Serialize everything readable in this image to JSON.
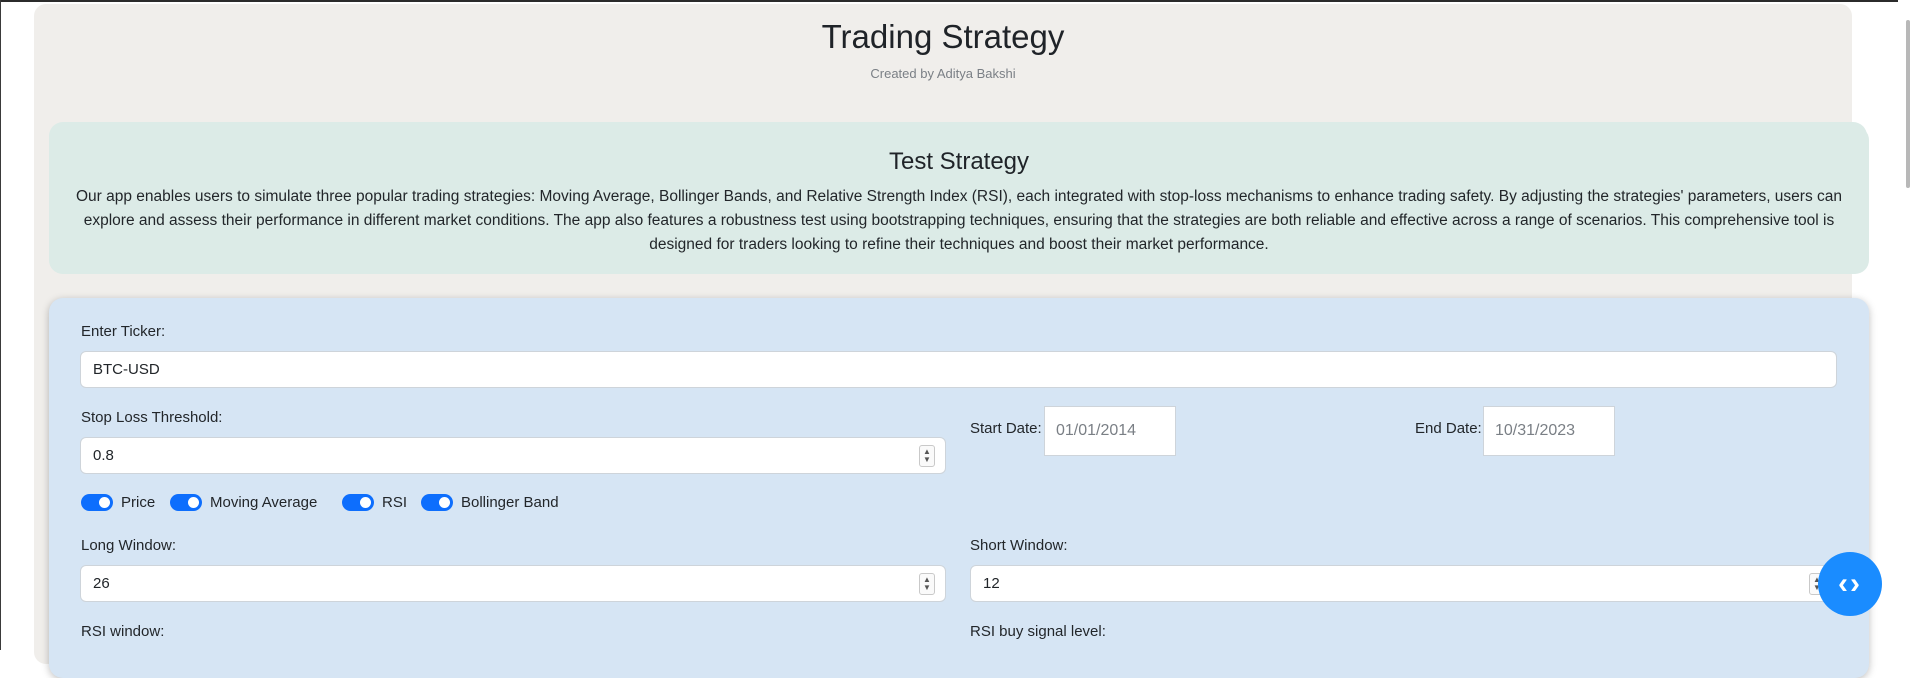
{
  "header": {
    "title": "Trading Strategy",
    "subtitle": "Created by Aditya Bakshi"
  },
  "about": {
    "title": "Test Strategy",
    "text": "Our app enables users to simulate three popular trading strategies: Moving Average, Bollinger Bands, and Relative Strength Index (RSI), each integrated with stop-loss mechanisms to enhance trading safety. By adjusting the strategies' parameters, users can explore and assess their performance in different market conditions. The app also features a robustness test using bootstrapping techniques, ensuring that the strategies are both reliable and effective across a range of scenarios. This comprehensive tool is designed for traders looking to refine their techniques and boost their market performance."
  },
  "form": {
    "ticker_label": "Enter Ticker:",
    "ticker_value": "BTC-USD",
    "stop_loss_label": "Stop Loss Threshold:",
    "stop_loss_value": "0.8",
    "start_date_label": "Start Date:",
    "start_date_value": "01/01/2014",
    "end_date_label": "End Date:",
    "end_date_value": "10/31/2023",
    "toggles": [
      {
        "label": "Price",
        "on": true
      },
      {
        "label": "Moving Average",
        "on": true
      },
      {
        "label": "RSI",
        "on": true
      },
      {
        "label": "Bollinger Band",
        "on": true
      }
    ],
    "long_window_label": "Long Window:",
    "long_window_value": "26",
    "short_window_label": "Short Window:",
    "short_window_value": "12",
    "rsi_window_label": "RSI window:",
    "rsi_buy_label": "RSI buy signal level:"
  },
  "fab_icon": "code-brackets-icon",
  "colors": {
    "accent": "#0d6efd",
    "fab": "#1a8cff",
    "about_bg": "#dcebe7",
    "form_bg": "#d6e5f4",
    "page_bg": "#f0eeeb"
  }
}
